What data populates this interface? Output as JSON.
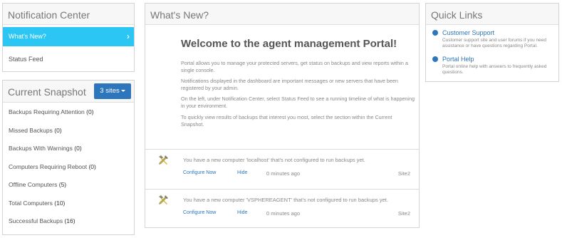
{
  "notification_center": {
    "title": "Notification Center",
    "items": [
      {
        "label": "What's New?",
        "chevron": "›"
      },
      {
        "label": "Status Feed"
      }
    ]
  },
  "snapshot": {
    "title": "Current Snapshot",
    "sites_button": "3 sites",
    "rows": [
      {
        "label": "Backups Requiring Attention",
        "count": "(0)"
      },
      {
        "label": "Missed Backups",
        "count": "(0)"
      },
      {
        "label": "Backups With Warnings",
        "count": "(0)"
      },
      {
        "label": "Computers Requiring Reboot",
        "count": "(0)"
      },
      {
        "label": "Offline Computers",
        "count": "(5)"
      },
      {
        "label": "Total Computers",
        "count": "(10)"
      },
      {
        "label": "Successful Backups",
        "count": "(16)"
      }
    ]
  },
  "whats_new": {
    "title": "What's New?",
    "welcome": "Welcome to the agent management Portal!",
    "paragraphs": [
      "Portal allows you to manage your protected servers, get status on backups and view reports within a single console.",
      "Notifications displayed in the dashboard are important messages or new servers that have been registered by your admin.",
      "On the left, under Notification Center, select Status Feed to see a running timeline of what is happening in your environment.",
      "To quickly view results of backups that interest you most, select the section within the Current Snapshot."
    ],
    "messages": [
      {
        "text": "You have a new computer 'localhost' that's not configured to run backups yet.",
        "configure": "Configure Now",
        "hide": "Hide",
        "time": "0 minutes ago",
        "site": "Site2"
      },
      {
        "text": "You have a new computer 'VSPHEREAGENT' that's not configured to run backups yet.",
        "configure": "Configure Now",
        "hide": "Hide",
        "time": "0 minutes ago",
        "site": "Site2"
      }
    ]
  },
  "quick_links": {
    "title": "Quick Links",
    "items": [
      {
        "label": "Customer Support",
        "desc": "Customer support site and user forums if you need assistance or have questions regarding Portal.",
        "icon": "globe-icon"
      },
      {
        "label": "Portal Help",
        "desc": "Portal online help with answers to frequently asked questions.",
        "icon": "globe-icon"
      }
    ]
  },
  "colors": {
    "accent": "#2cc6f5",
    "button": "#2d76bb",
    "link": "#2d76bb"
  }
}
